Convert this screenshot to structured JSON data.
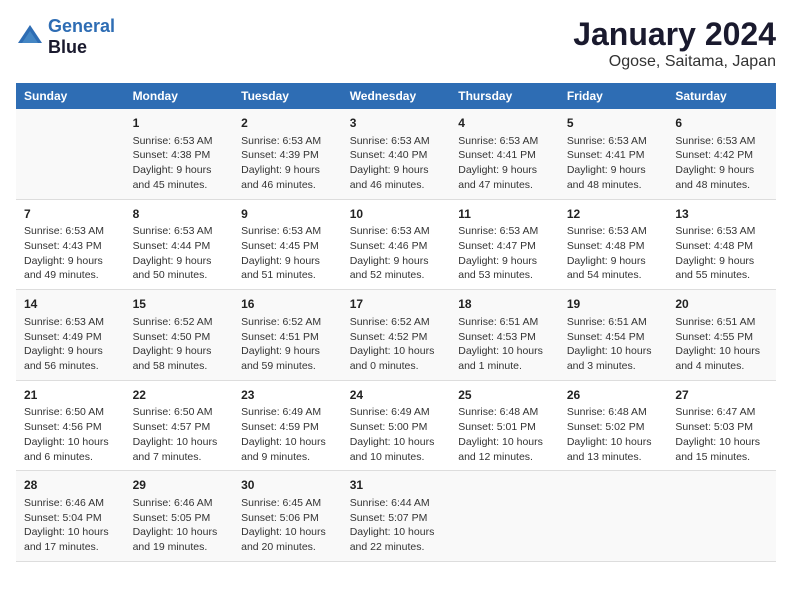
{
  "header": {
    "logo_line1": "General",
    "logo_line2": "Blue",
    "month": "January 2024",
    "location": "Ogose, Saitama, Japan"
  },
  "days_of_week": [
    "Sunday",
    "Monday",
    "Tuesday",
    "Wednesday",
    "Thursday",
    "Friday",
    "Saturday"
  ],
  "weeks": [
    [
      {
        "num": "",
        "sunrise": "",
        "sunset": "",
        "daylight": ""
      },
      {
        "num": "1",
        "sunrise": "Sunrise: 6:53 AM",
        "sunset": "Sunset: 4:38 PM",
        "daylight": "Daylight: 9 hours and 45 minutes."
      },
      {
        "num": "2",
        "sunrise": "Sunrise: 6:53 AM",
        "sunset": "Sunset: 4:39 PM",
        "daylight": "Daylight: 9 hours and 46 minutes."
      },
      {
        "num": "3",
        "sunrise": "Sunrise: 6:53 AM",
        "sunset": "Sunset: 4:40 PM",
        "daylight": "Daylight: 9 hours and 46 minutes."
      },
      {
        "num": "4",
        "sunrise": "Sunrise: 6:53 AM",
        "sunset": "Sunset: 4:41 PM",
        "daylight": "Daylight: 9 hours and 47 minutes."
      },
      {
        "num": "5",
        "sunrise": "Sunrise: 6:53 AM",
        "sunset": "Sunset: 4:41 PM",
        "daylight": "Daylight: 9 hours and 48 minutes."
      },
      {
        "num": "6",
        "sunrise": "Sunrise: 6:53 AM",
        "sunset": "Sunset: 4:42 PM",
        "daylight": "Daylight: 9 hours and 48 minutes."
      }
    ],
    [
      {
        "num": "7",
        "sunrise": "Sunrise: 6:53 AM",
        "sunset": "Sunset: 4:43 PM",
        "daylight": "Daylight: 9 hours and 49 minutes."
      },
      {
        "num": "8",
        "sunrise": "Sunrise: 6:53 AM",
        "sunset": "Sunset: 4:44 PM",
        "daylight": "Daylight: 9 hours and 50 minutes."
      },
      {
        "num": "9",
        "sunrise": "Sunrise: 6:53 AM",
        "sunset": "Sunset: 4:45 PM",
        "daylight": "Daylight: 9 hours and 51 minutes."
      },
      {
        "num": "10",
        "sunrise": "Sunrise: 6:53 AM",
        "sunset": "Sunset: 4:46 PM",
        "daylight": "Daylight: 9 hours and 52 minutes."
      },
      {
        "num": "11",
        "sunrise": "Sunrise: 6:53 AM",
        "sunset": "Sunset: 4:47 PM",
        "daylight": "Daylight: 9 hours and 53 minutes."
      },
      {
        "num": "12",
        "sunrise": "Sunrise: 6:53 AM",
        "sunset": "Sunset: 4:48 PM",
        "daylight": "Daylight: 9 hours and 54 minutes."
      },
      {
        "num": "13",
        "sunrise": "Sunrise: 6:53 AM",
        "sunset": "Sunset: 4:48 PM",
        "daylight": "Daylight: 9 hours and 55 minutes."
      }
    ],
    [
      {
        "num": "14",
        "sunrise": "Sunrise: 6:53 AM",
        "sunset": "Sunset: 4:49 PM",
        "daylight": "Daylight: 9 hours and 56 minutes."
      },
      {
        "num": "15",
        "sunrise": "Sunrise: 6:52 AM",
        "sunset": "Sunset: 4:50 PM",
        "daylight": "Daylight: 9 hours and 58 minutes."
      },
      {
        "num": "16",
        "sunrise": "Sunrise: 6:52 AM",
        "sunset": "Sunset: 4:51 PM",
        "daylight": "Daylight: 9 hours and 59 minutes."
      },
      {
        "num": "17",
        "sunrise": "Sunrise: 6:52 AM",
        "sunset": "Sunset: 4:52 PM",
        "daylight": "Daylight: 10 hours and 0 minutes."
      },
      {
        "num": "18",
        "sunrise": "Sunrise: 6:51 AM",
        "sunset": "Sunset: 4:53 PM",
        "daylight": "Daylight: 10 hours and 1 minute."
      },
      {
        "num": "19",
        "sunrise": "Sunrise: 6:51 AM",
        "sunset": "Sunset: 4:54 PM",
        "daylight": "Daylight: 10 hours and 3 minutes."
      },
      {
        "num": "20",
        "sunrise": "Sunrise: 6:51 AM",
        "sunset": "Sunset: 4:55 PM",
        "daylight": "Daylight: 10 hours and 4 minutes."
      }
    ],
    [
      {
        "num": "21",
        "sunrise": "Sunrise: 6:50 AM",
        "sunset": "Sunset: 4:56 PM",
        "daylight": "Daylight: 10 hours and 6 minutes."
      },
      {
        "num": "22",
        "sunrise": "Sunrise: 6:50 AM",
        "sunset": "Sunset: 4:57 PM",
        "daylight": "Daylight: 10 hours and 7 minutes."
      },
      {
        "num": "23",
        "sunrise": "Sunrise: 6:49 AM",
        "sunset": "Sunset: 4:59 PM",
        "daylight": "Daylight: 10 hours and 9 minutes."
      },
      {
        "num": "24",
        "sunrise": "Sunrise: 6:49 AM",
        "sunset": "Sunset: 5:00 PM",
        "daylight": "Daylight: 10 hours and 10 minutes."
      },
      {
        "num": "25",
        "sunrise": "Sunrise: 6:48 AM",
        "sunset": "Sunset: 5:01 PM",
        "daylight": "Daylight: 10 hours and 12 minutes."
      },
      {
        "num": "26",
        "sunrise": "Sunrise: 6:48 AM",
        "sunset": "Sunset: 5:02 PM",
        "daylight": "Daylight: 10 hours and 13 minutes."
      },
      {
        "num": "27",
        "sunrise": "Sunrise: 6:47 AM",
        "sunset": "Sunset: 5:03 PM",
        "daylight": "Daylight: 10 hours and 15 minutes."
      }
    ],
    [
      {
        "num": "28",
        "sunrise": "Sunrise: 6:46 AM",
        "sunset": "Sunset: 5:04 PM",
        "daylight": "Daylight: 10 hours and 17 minutes."
      },
      {
        "num": "29",
        "sunrise": "Sunrise: 6:46 AM",
        "sunset": "Sunset: 5:05 PM",
        "daylight": "Daylight: 10 hours and 19 minutes."
      },
      {
        "num": "30",
        "sunrise": "Sunrise: 6:45 AM",
        "sunset": "Sunset: 5:06 PM",
        "daylight": "Daylight: 10 hours and 20 minutes."
      },
      {
        "num": "31",
        "sunrise": "Sunrise: 6:44 AM",
        "sunset": "Sunset: 5:07 PM",
        "daylight": "Daylight: 10 hours and 22 minutes."
      },
      {
        "num": "",
        "sunrise": "",
        "sunset": "",
        "daylight": ""
      },
      {
        "num": "",
        "sunrise": "",
        "sunset": "",
        "daylight": ""
      },
      {
        "num": "",
        "sunrise": "",
        "sunset": "",
        "daylight": ""
      }
    ]
  ]
}
